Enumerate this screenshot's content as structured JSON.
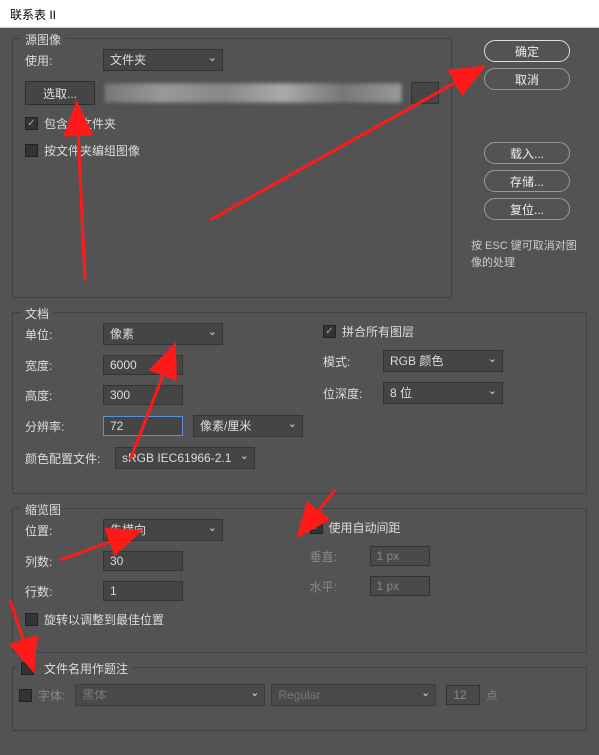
{
  "title": "联系表 II",
  "buttons": {
    "ok": "确定",
    "cancel": "取消",
    "load": "载入...",
    "save": "存储...",
    "reset": "复位..."
  },
  "esc_note": "按 ESC 键可取消对图像的处理",
  "source": {
    "title": "源图像",
    "use_label": "使用:",
    "use_value": "文件夹",
    "choose": "选取...",
    "include_sub": "包含子文件夹",
    "include_sub_checked": true,
    "group_by_folder": "按文件夹编组图像",
    "group_checked": false
  },
  "document": {
    "title": "文档",
    "unit_label": "单位:",
    "unit_value": "像素",
    "width_label": "宽度:",
    "width_value": "6000",
    "height_label": "高度:",
    "height_value": "300",
    "res_label": "分辨率:",
    "res_value": "72",
    "res_unit": "像素/厘米",
    "profile_label": "颜色配置文件:",
    "profile_value": "sRGB IEC61966-2.1",
    "flatten_label": "拼合所有图层",
    "flatten_checked": true,
    "mode_label": "模式:",
    "mode_value": "RGB 颜色",
    "depth_label": "位深度:",
    "depth_value": "8 位"
  },
  "thumb": {
    "title": "缩览图",
    "place_label": "位置:",
    "place_value": "先横向",
    "cols_label": "列数:",
    "cols_value": "30",
    "rows_label": "行数:",
    "rows_value": "1",
    "rotate_label": "旋转以调整到最佳位置",
    "rotate_checked": false,
    "auto_label": "使用自动间距",
    "auto_checked": true,
    "vert_label": "垂直:",
    "vert_value": "1 px",
    "horz_label": "水平:",
    "horz_value": "1 px"
  },
  "caption": {
    "title": "文件名用作题注",
    "enabled": false,
    "font_label": "字体:",
    "font_value": "黑体",
    "style_value": "Regular",
    "size_value": "12",
    "pt": "点"
  }
}
